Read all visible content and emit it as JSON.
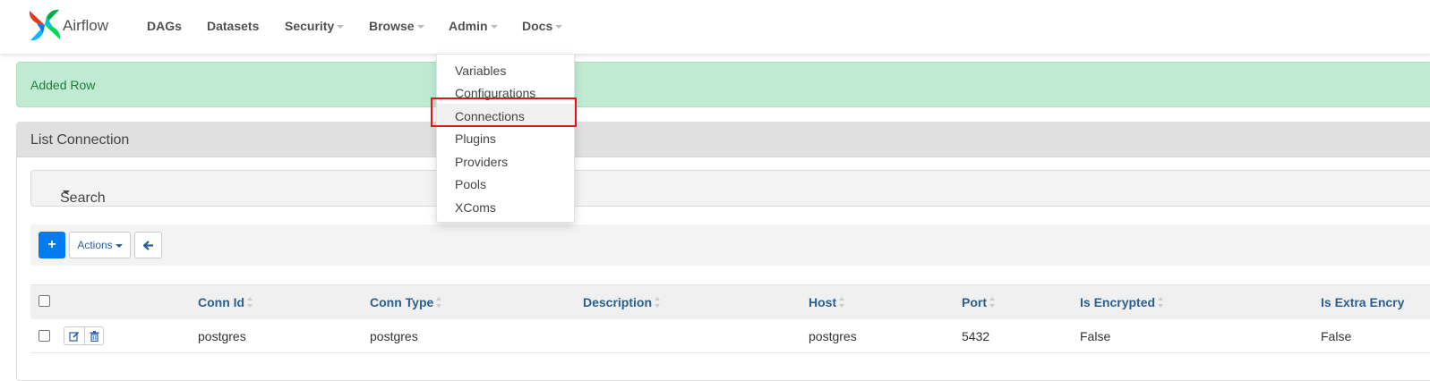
{
  "brand": {
    "name": "Airflow",
    "logo_icon": "airflow-pinwheel-icon"
  },
  "nav": {
    "dags": "DAGs",
    "datasets": "Datasets",
    "security": "Security",
    "browse": "Browse",
    "admin": "Admin",
    "docs": "Docs"
  },
  "admin_menu": {
    "items": [
      "Variables",
      "Configurations",
      "Connections",
      "Plugins",
      "Providers",
      "Pools",
      "XComs"
    ],
    "highlighted": "Connections"
  },
  "alert": {
    "message": "Added Row",
    "color": "#c1ead3"
  },
  "panel": {
    "title": "List Connection"
  },
  "search": {
    "label": "Search"
  },
  "toolbar": {
    "add_label": "+",
    "actions_label": "Actions",
    "back_icon": "arrow-left-icon"
  },
  "table": {
    "columns": [
      "Conn Id",
      "Conn Type",
      "Description",
      "Host",
      "Port",
      "Is Encrypted",
      "Is Extra Encry"
    ],
    "rows": [
      {
        "conn_id": "postgres",
        "conn_type": "postgres",
        "description": "",
        "host": "postgres",
        "port": "5432",
        "is_encrypted": "False",
        "is_extra_encrypted": "False"
      }
    ]
  },
  "colors": {
    "primary": "#017cee",
    "header_link": "#2b5f8e",
    "highlight_box": "#e0161b"
  }
}
